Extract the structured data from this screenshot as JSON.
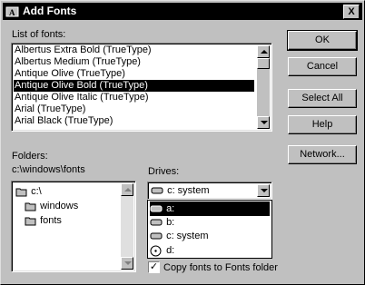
{
  "title": "Add Fonts",
  "list_label": "List of fonts:",
  "fonts": [
    "Albertus Extra Bold (TrueType)",
    "Albertus Medium (TrueType)",
    "Antique Olive (TrueType)",
    "Antique Olive Bold (TrueType)",
    "Antique Olive Italic (TrueType)",
    "Arial (TrueType)",
    "Arial Black (TrueType)"
  ],
  "selected_font_index": 3,
  "folders_label": "Folders:",
  "current_path": "c:\\windows\\fonts",
  "folders": [
    "c:\\",
    "windows",
    "fonts"
  ],
  "drives_label": "Drives:",
  "drive_selected": "c: system",
  "drives": [
    "a:",
    "b:",
    "c: system",
    "d:"
  ],
  "copy_checkbox": {
    "label": "Copy fonts to Fonts folder",
    "checked": true
  },
  "buttons": {
    "ok": "OK",
    "cancel": "Cancel",
    "select_all": "Select All",
    "help": "Help",
    "network": "Network..."
  },
  "close_glyph": "X",
  "check_glyph": "✓"
}
